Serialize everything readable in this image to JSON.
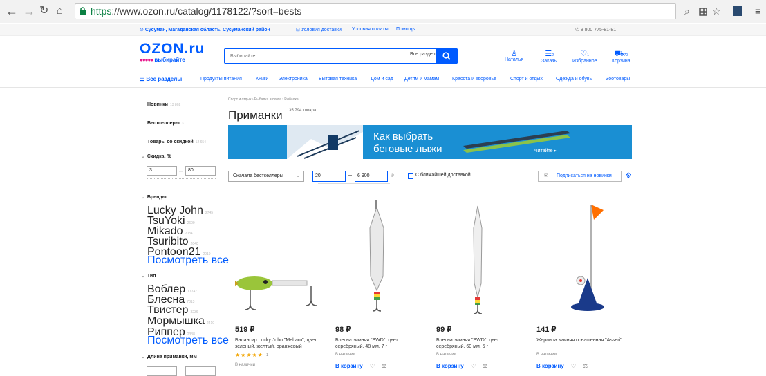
{
  "browser": {
    "url_https": "https",
    "url_rest": "://www.ozon.ru/catalog/1178122/?sort=bests"
  },
  "topbar": {
    "location": "Сусуман, Магаданская область, Сусуманский район",
    "delivery": "Условия доставки",
    "payment": "Условия оплаты",
    "help": "Помощь",
    "phone": "8 800 775-81-81"
  },
  "header": {
    "logo": "OZON.ru",
    "slogan": "выбирайте",
    "search_placeholder": "Выбирайте...",
    "search_scope": "Все разделы",
    "user": "Наталья",
    "orders": "Заказы",
    "orders_count": "2",
    "favorites": "Избранное",
    "favorites_count": "1",
    "cart": "Корзина",
    "cart_count": "70"
  },
  "menu": {
    "all": "Все разделы",
    "items": [
      "Продукты питания",
      "Книги",
      "Электроника",
      "Бытовая техника",
      "Дом и сад",
      "Детям и мамам",
      "Красота и здоровье",
      "Спорт и отдых",
      "Одежда и обувь",
      "Зоотовары"
    ]
  },
  "sidebar": {
    "new": "Новинки",
    "new_count": "13 802",
    "best": "Бестселлеры",
    "best_count": "3",
    "discount_goods": "Товары со скидкой",
    "discount_goods_count": "12 654",
    "discount_title": "Скидка, %",
    "discount_from": "3",
    "discount_to": "80",
    "brands_title": "Бренды",
    "brands": [
      {
        "name": "Lucky John",
        "count": "2745"
      },
      {
        "name": "TsuYoki",
        "count": "2609"
      },
      {
        "name": "Mikado",
        "count": "2084"
      },
      {
        "name": "Tsuribito",
        "count": "2040"
      },
      {
        "name": "Pontoon21",
        "count": "2019"
      }
    ],
    "see_all": "Посмотреть все",
    "type_title": "Тип",
    "types": [
      {
        "name": "Воблер",
        "count": "17747"
      },
      {
        "name": "Блесна",
        "count": "7813"
      },
      {
        "name": "Твистер",
        "count": "3236"
      },
      {
        "name": "Мормышка",
        "count": "2410"
      },
      {
        "name": "Риппер",
        "count": "2338"
      }
    ],
    "see_all2": "Посмотреть все",
    "length_title": "Длина приманки, мм"
  },
  "main": {
    "breadcrumb": "Спорт и отдых › Рыбалка и охота › Рыбалка",
    "title": "Приманки",
    "count": "35 794 товара",
    "banner_line1": "Как выбрать",
    "banner_line2": "беговые лыжи",
    "banner_read": "Читайте ▸",
    "sort": "Сначала бестселлеры",
    "price_from": "20",
    "price_to": "6 900",
    "currency": "₽",
    "fast_delivery": "С ближайшей доставкой",
    "subscribe": "Подписаться на новинки"
  },
  "products": [
    {
      "price": "519 ₽",
      "name": "Балансир Lucky John \"Mebaru\", цвет: зеленый, желтый, оранжевый",
      "stars": "★★★★★",
      "reviews": "1",
      "avail": "В наличии",
      "cart": ""
    },
    {
      "price": "98 ₽",
      "name": "Блесна зимняя \"SWD\", цвет: серебряный, 48 мм, 7 г",
      "stars": "",
      "reviews": "",
      "avail": "В наличии",
      "cart": "В корзину"
    },
    {
      "price": "99 ₽",
      "name": "Блесна зимняя \"SWD\", цвет: серебряный, 60 мм, 5 г",
      "stars": "",
      "reviews": "",
      "avail": "В наличии",
      "cart": "В корзину"
    },
    {
      "price": "141 ₽",
      "name": "Жерлица зимняя оснащенная \"Asseri\"",
      "stars": "",
      "reviews": "",
      "avail": "В наличии",
      "cart": "В корзину"
    }
  ]
}
